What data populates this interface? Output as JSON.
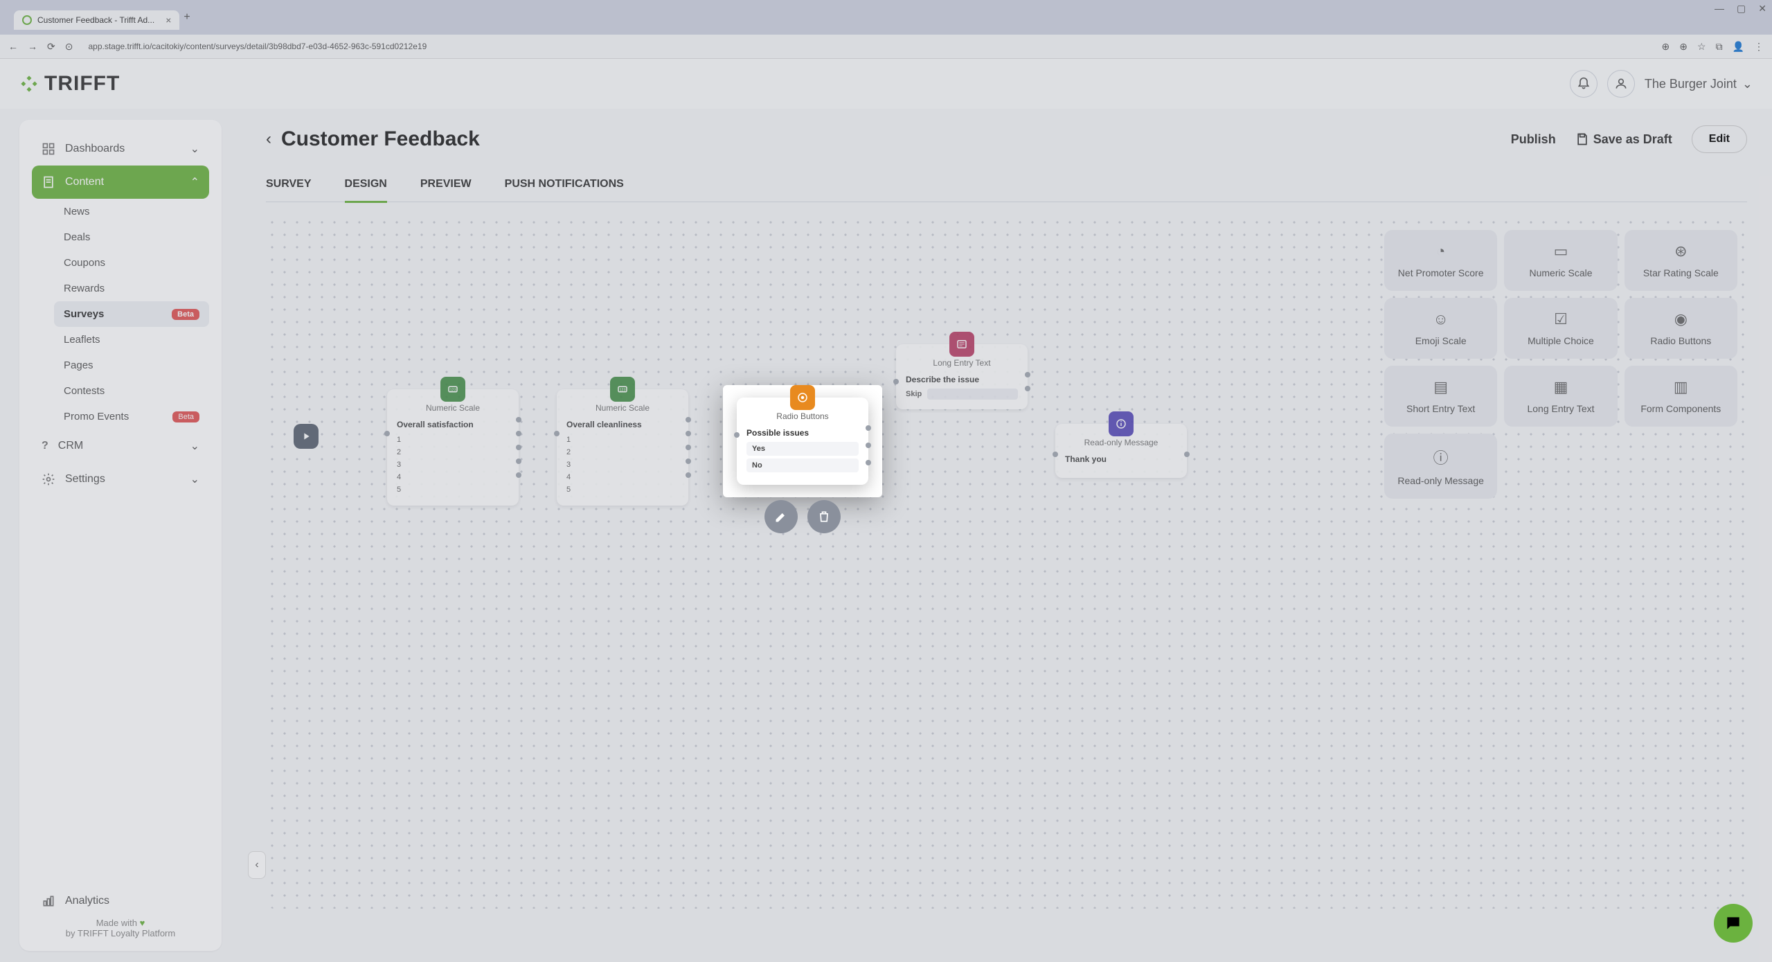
{
  "browser": {
    "tab_title": "Customer Feedback - Trifft Ad...",
    "url": "app.stage.trifft.io/cacitokiy/content/surveys/detail/3b98dbd7-e03d-4652-963c-591cd0212e19"
  },
  "header": {
    "brand": "TRIFFT",
    "org_name": "The Burger Joint"
  },
  "sidebar": {
    "dashboards": "Dashboards",
    "content": "Content",
    "items": [
      {
        "label": "News"
      },
      {
        "label": "Deals"
      },
      {
        "label": "Coupons"
      },
      {
        "label": "Rewards"
      },
      {
        "label": "Surveys",
        "badge": "Beta",
        "active": true
      },
      {
        "label": "Leaflets"
      },
      {
        "label": "Pages"
      },
      {
        "label": "Contests"
      },
      {
        "label": "Promo Events",
        "badge": "Beta"
      }
    ],
    "crm": "CRM",
    "settings": "Settings",
    "analytics": "Analytics",
    "footer_line1": "Made with",
    "footer_line2": "by TRIFFT Loyalty Platform"
  },
  "page": {
    "title": "Customer Feedback",
    "actions": {
      "publish": "Publish",
      "save_draft": "Save as Draft",
      "edit": "Edit"
    },
    "tabs": [
      "SURVEY",
      "DESIGN",
      "PREVIEW",
      "PUSH NOTIFICATIONS"
    ],
    "active_tab": 1
  },
  "canvas": {
    "nodes": {
      "numeric1": {
        "type": "Numeric Scale",
        "question": "Overall satisfaction",
        "options": [
          "1",
          "2",
          "3",
          "4",
          "5"
        ],
        "color": "#3a8a3d"
      },
      "numeric2": {
        "type": "Numeric Scale",
        "question": "Overall cleanliness",
        "options": [
          "1",
          "2",
          "3",
          "4",
          "5"
        ],
        "color": "#3a8a3d"
      },
      "radio": {
        "type": "Radio Buttons",
        "question": "Possible issues",
        "options": [
          "Yes",
          "No"
        ],
        "color": "#e88a1f"
      },
      "longtext": {
        "type": "Long Entry Text",
        "question": "Describe the issue",
        "skip": "Skip",
        "color": "#b5305a"
      },
      "readonly": {
        "type": "Read-only Message",
        "question": "Thank you",
        "color": "#4b3db5"
      }
    }
  },
  "palette": [
    {
      "label": "Net Promoter Score",
      "icon": "gauge"
    },
    {
      "label": "Numeric Scale",
      "icon": "numeric"
    },
    {
      "label": "Star Rating Scale",
      "icon": "star"
    },
    {
      "label": "Emoji Scale",
      "icon": "emoji"
    },
    {
      "label": "Multiple Choice",
      "icon": "check"
    },
    {
      "label": "Radio Buttons",
      "icon": "radio"
    },
    {
      "label": "Short Entry Text",
      "icon": "short"
    },
    {
      "label": "Long Entry Text",
      "icon": "long"
    },
    {
      "label": "Form Components",
      "icon": "form"
    },
    {
      "label": "Read-only Message",
      "icon": "info"
    }
  ]
}
